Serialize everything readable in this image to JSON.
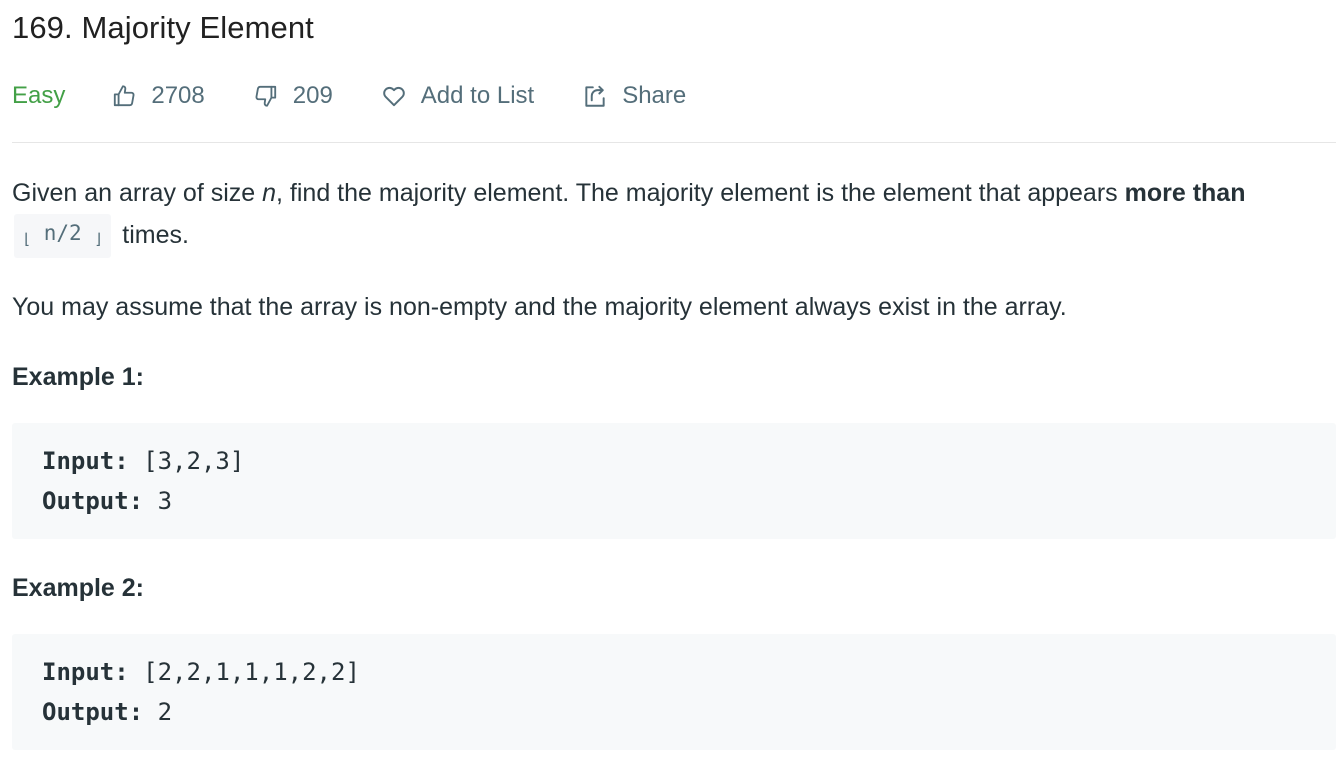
{
  "problem": {
    "title": "169. Majority Element",
    "difficulty": "Easy",
    "likes": "2708",
    "dislikes": "209",
    "add_to_list": "Add to List",
    "share": "Share"
  },
  "description": {
    "p1_a": "Given an array of size ",
    "p1_n": "n",
    "p1_b": ", find the majority element. The majority element is the element that appears ",
    "p1_bold": "more than",
    "p1_code": "n/2",
    "p1_c": " times.",
    "p2": "You may assume that the array is non-empty and the majority element always exist in the array."
  },
  "examples": [
    {
      "title": "Example 1:",
      "input_label": "Input:",
      "input_value": " [3,2,3]",
      "output_label": "Output:",
      "output_value": " 3"
    },
    {
      "title": "Example 2:",
      "input_label": "Input:",
      "input_value": " [2,2,1,1,1,2,2]",
      "output_label": "Output:",
      "output_value": " 2"
    }
  ],
  "icons": {
    "like": "thumbs-up-icon",
    "dislike": "thumbs-down-icon",
    "add": "heart-icon",
    "share": "share-icon"
  },
  "colors": {
    "difficulty_easy": "#43a047",
    "meta_text": "#546e7a",
    "code_bg": "#f7f9fa"
  }
}
